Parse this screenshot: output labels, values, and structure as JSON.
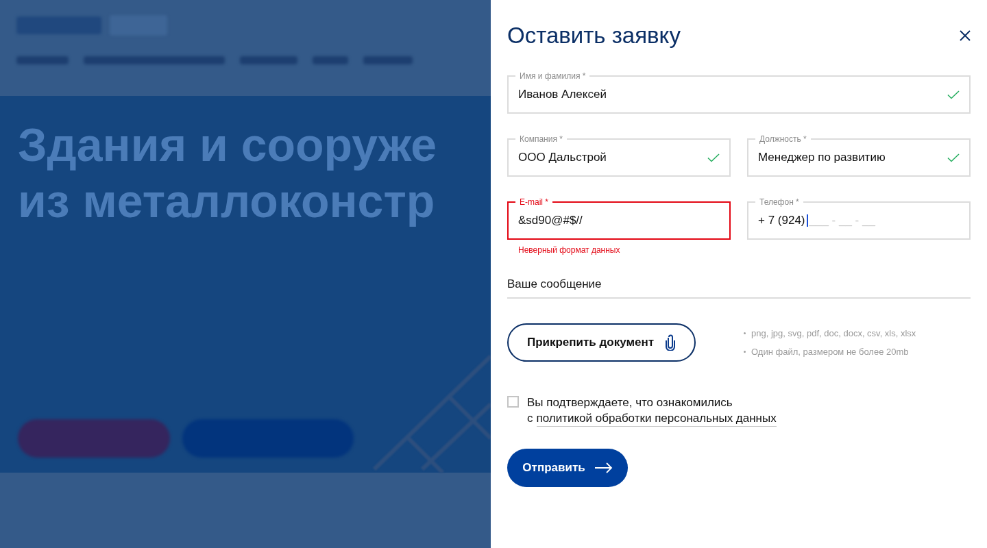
{
  "background_page": {
    "hero_title": [
      "Здания и сооруже",
      "из металлоконстр"
    ]
  },
  "dialog": {
    "title": "Оставить заявку",
    "rows": [
      [
        {
          "label": "Имя и фамилия *",
          "value": "Иванов Алексей",
          "valid": true,
          "invalid": false
        }
      ],
      [
        {
          "label": "Компания *",
          "value": "ООО Дальстрой",
          "valid": true,
          "invalid": false
        },
        {
          "label": "Должность *",
          "value": "Менеджер по развитию",
          "valid": true,
          "invalid": false
        }
      ],
      [
        {
          "label": "E-mail *",
          "value": "&sd90@#$//",
          "valid": false,
          "invalid": true,
          "error_message": "Неверный формат данных"
        },
        {
          "label": "Телефон *",
          "value": "+ 7 (924)",
          "placeholder": "___ - __ - __",
          "valid": false,
          "invalid": false,
          "focused": true
        }
      ]
    ],
    "message": {
      "placeholder": "Ваше сообщение"
    },
    "attach": {
      "label": "Прикрепить документ"
    },
    "notes": [
      "png, jpg, svg, pdf, doc, docx, csv, xls, xlsx",
      "Один файл, размером не более 20mb"
    ],
    "consent": {
      "checked": false,
      "text": "Вы подтверждаете, что ознакомились",
      "prefix": "с",
      "link": "политикой обработки персональных данных"
    },
    "submit": "Отправить"
  }
}
